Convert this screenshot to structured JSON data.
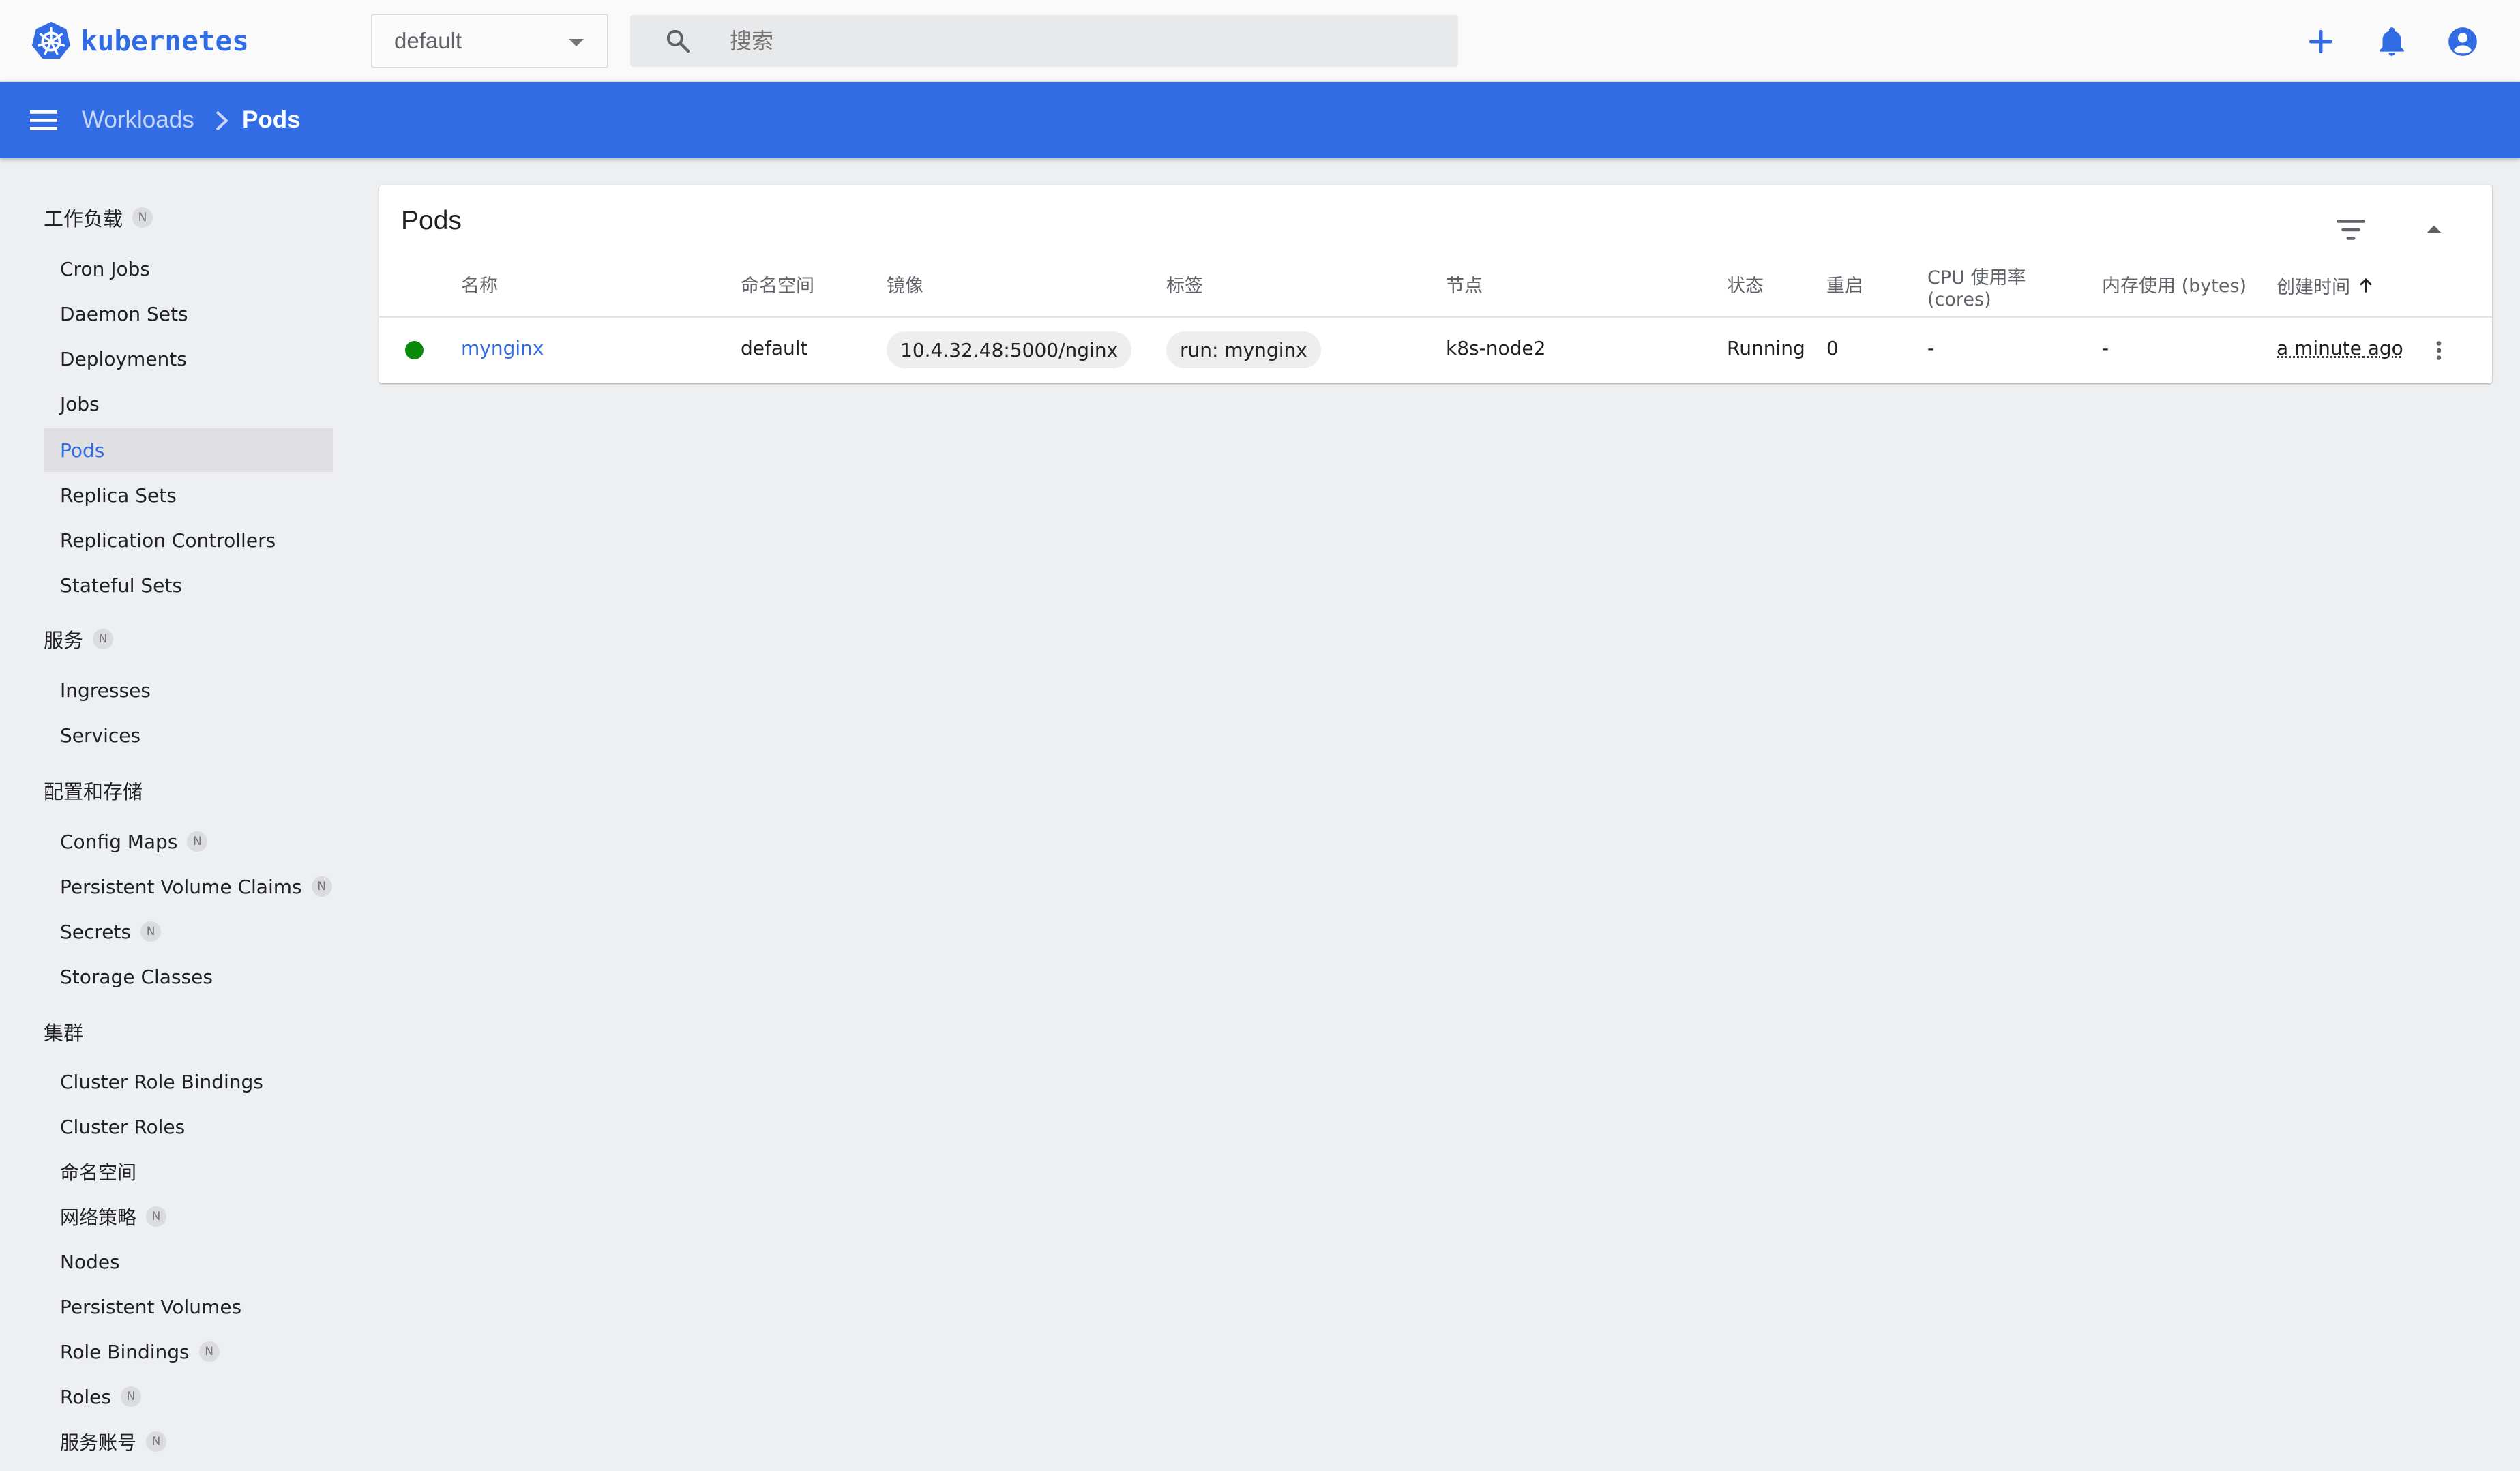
{
  "app": {
    "brand_name": "kubernetes",
    "namespace_selected": "default",
    "search_placeholder": "搜索",
    "colors": {
      "brand": "#326ce5",
      "header": "#326ce5",
      "running": "#0a8a0a"
    }
  },
  "top_icons": [
    "plus-icon",
    "bell-icon",
    "account-icon"
  ],
  "breadcrumb": {
    "parent": "Workloads",
    "current": "Pods"
  },
  "sidebar": {
    "sections": [
      {
        "label": "工作负载",
        "badge": "N"
      },
      {
        "label": "服务",
        "badge": "N"
      },
      {
        "label": "配置和存储",
        "badge": ""
      },
      {
        "label": "集群",
        "badge": ""
      }
    ],
    "items": [
      {
        "label": "Cron Jobs",
        "badge": ""
      },
      {
        "label": "Daemon Sets",
        "badge": ""
      },
      {
        "label": "Deployments",
        "badge": ""
      },
      {
        "label": "Jobs",
        "badge": ""
      },
      {
        "label": "Pods",
        "badge": "",
        "active": true
      },
      {
        "label": "Replica Sets",
        "badge": ""
      },
      {
        "label": "Replication Controllers",
        "badge": ""
      },
      {
        "label": "Stateful Sets",
        "badge": ""
      },
      {
        "label": "Ingresses",
        "badge": ""
      },
      {
        "label": "Services",
        "badge": ""
      },
      {
        "label": "Config Maps",
        "badge": "N"
      },
      {
        "label": "Persistent Volume Claims",
        "badge": "N"
      },
      {
        "label": "Secrets",
        "badge": "N"
      },
      {
        "label": "Storage Classes",
        "badge": ""
      },
      {
        "label": "Cluster Role Bindings",
        "badge": ""
      },
      {
        "label": "Cluster Roles",
        "badge": ""
      },
      {
        "label": "命名空间",
        "badge": ""
      },
      {
        "label": "网络策略",
        "badge": "N"
      },
      {
        "label": "Nodes",
        "badge": ""
      },
      {
        "label": "Persistent Volumes",
        "badge": ""
      },
      {
        "label": "Role Bindings",
        "badge": "N"
      },
      {
        "label": "Roles",
        "badge": "N"
      },
      {
        "label": "服务账号",
        "badge": "N"
      }
    ]
  },
  "pods_card": {
    "title": "Pods",
    "columns": {
      "name": "名称",
      "namespace": "命名空间",
      "image": "镜像",
      "labels": "标签",
      "node": "节点",
      "status": "状态",
      "restarts": "重启",
      "cpu_line1": "CPU 使用率",
      "cpu_line2": "(cores)",
      "memory": "内存使用 (bytes)",
      "created": "创建时间"
    },
    "rows": [
      {
        "name": "mynginx",
        "namespace": "default",
        "image": "10.4.32.48:5000/nginx",
        "labels": "run: mynginx",
        "node": "k8s-node2",
        "status": "Running",
        "restarts": "0",
        "cpu": "-",
        "memory": "-",
        "created": "a minute ago"
      }
    ]
  }
}
